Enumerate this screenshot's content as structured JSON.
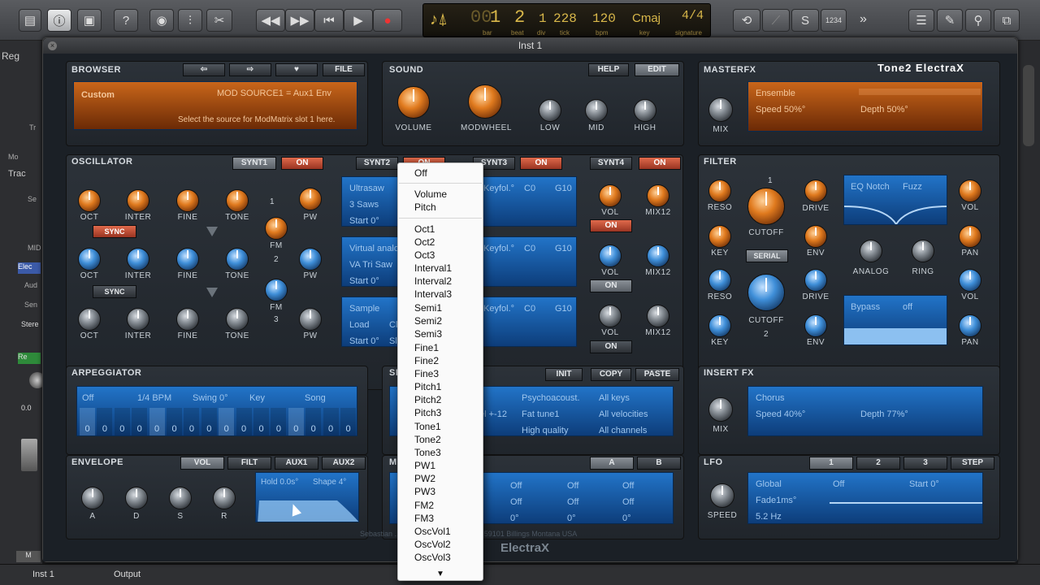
{
  "toolbar": {
    "lcd": {
      "bar": "1",
      "beat": "2",
      "div": "1",
      "tick": "228",
      "bpm": "120",
      "key": "Cmaj",
      "signature": "4/4",
      "bar_lbl": "bar",
      "beat_lbl": "beat",
      "div_lbl": "div",
      "tick_lbl": "tick",
      "bpm_lbl": "bpm",
      "key_lbl": "key",
      "sig_lbl": "signature",
      "prefix": "00"
    },
    "count_in": "1234"
  },
  "left": {
    "items": [
      "Reg",
      "Tr",
      "Mo",
      "Trac",
      "Se",
      "MID",
      "Elec",
      "Aud",
      "Sen",
      "Stere",
      "Re",
      "0.0",
      "M"
    ]
  },
  "bottom": {
    "tab1": "Inst 1",
    "tab2": "Output"
  },
  "window": {
    "title": "Inst 1"
  },
  "brand": "Tone2 ElectraX",
  "footer": {
    "brand": "ElectraX",
    "credit": "Sebastian ... maver@gmail.com 2316 59101 Billings Montana USA"
  },
  "browser": {
    "title": "BROWSER",
    "file": "FILE",
    "preset": "Custom",
    "mod_source": "MOD SOURCE1 = Aux1 Env",
    "hint": "Select the source for ModMatrix slot 1 here."
  },
  "sound": {
    "title": "SOUND",
    "help": "HELP",
    "edit": "EDIT",
    "knobs": [
      "VOLUME",
      "MODWHEEL",
      "LOW",
      "MID",
      "HIGH"
    ]
  },
  "masterfx": {
    "title": "MASTERFX",
    "fx": "Ensemble",
    "speed": "Speed 50%°",
    "depth": "Depth 50%°",
    "mix": "MIX"
  },
  "oscillator": {
    "title": "OSCILLATOR",
    "synths": [
      "SYNT1",
      "SYNT2",
      "SYNT3",
      "SYNT4"
    ],
    "on": "ON",
    "sync": "SYNC",
    "row_labels": [
      "OCT",
      "INTER",
      "FINE",
      "TONE",
      "PW"
    ],
    "fm": "FM",
    "fm2": "2",
    "fm3": "3",
    "fm_top": "1",
    "disp1": {
      "a": "Ultrasaw",
      "b": "3 Saws",
      "c": "Start 0°",
      "k": "Keyfol.°",
      "c0": "C0",
      "g10": "G10"
    },
    "disp2": {
      "a": "Virtual analo",
      "b": "VA Tri Saw",
      "c": "Start 0°",
      "k": "Keyfol.°",
      "c0": "C0",
      "g10": "G10"
    },
    "disp3": {
      "a": "Sample",
      "b": "Load",
      "b2": "Cl",
      "c": "Start 0°",
      "c2": "Sl",
      "k": "Keyfol.°",
      "c0": "C0",
      "g10": "G10"
    },
    "vol": "VOL",
    "mix12": "MIX12"
  },
  "filter": {
    "title": "FILTER",
    "reso": "RESO",
    "key": "KEY",
    "cutoff": "CUTOFF",
    "cutoff2": "2",
    "one": "1",
    "drive": "DRIVE",
    "env": "ENV",
    "serial": "SERIAL",
    "analog": "ANALOG",
    "ring": "RING",
    "vol": "VOL",
    "pan": "PAN",
    "eq": "EQ Notch",
    "fuzz": "Fuzz",
    "bypass": "Bypass",
    "off": "off"
  },
  "arp": {
    "title": "ARPEGGIATOR",
    "off": "Off",
    "bpm": "1/4 BPM",
    "swing": "Swing 0°",
    "key": "Key",
    "song": "Song",
    "steps": [
      "0",
      "0",
      "0",
      "0",
      "0",
      "0",
      "0",
      "0",
      "0",
      "0",
      "0",
      "0",
      "0",
      "0",
      "0",
      "0"
    ]
  },
  "seq": {
    "init": "INIT",
    "copy": "COPY",
    "paste": "PASTE",
    "t1": "Psychoacoust.",
    "t2": "Fat tune1",
    "t3": "High quality",
    "t4": "All keys",
    "t5": "All velocities",
    "t6": "All channels",
    "t7": "el +-12",
    "cut": "SE"
  },
  "insertfx": {
    "title": "INSERT FX",
    "fx": "Chorus",
    "speed": "Speed 40%°",
    "depth": "Depth 77%°",
    "mix": "MIX"
  },
  "envelope": {
    "title": "ENVELOPE",
    "tabs": [
      "VOL",
      "FILT",
      "AUX1",
      "AUX2"
    ],
    "knobs": [
      "A",
      "D",
      "S",
      "R"
    ],
    "hold": "Hold 0.0s°",
    "shape": "Shape 4°"
  },
  "mod": {
    "cut": "M",
    "a": "A",
    "b": "B",
    "off": "Off",
    "deg": "0°"
  },
  "lfo": {
    "title": "LFO",
    "tabs": [
      "1",
      "2",
      "3",
      "STEP"
    ],
    "global": "Global",
    "off": "Off",
    "start": "Start 0°",
    "fade": "Fade1ms°",
    "rate": "5.2 Hz",
    "speed": "SPEED"
  },
  "menu": {
    "items": [
      "Off",
      "Volume",
      "Pitch",
      "Oct1",
      "Oct2",
      "Oct3",
      "Interval1",
      "Interval2",
      "Interval3",
      "Semi1",
      "Semi2",
      "Semi3",
      "Fine1",
      "Fine2",
      "Fine3",
      "Pitch1",
      "Pitch2",
      "Pitch3",
      "Tone1",
      "Tone2",
      "Tone3",
      "PW1",
      "PW2",
      "PW3",
      "FM2",
      "FM3",
      "OscVol1",
      "OscVol2",
      "OscVol3"
    ]
  },
  "colors": {
    "accent_orange": "#e07a1e",
    "accent_blue": "#2274c8",
    "on_red": "#e06a4b"
  }
}
